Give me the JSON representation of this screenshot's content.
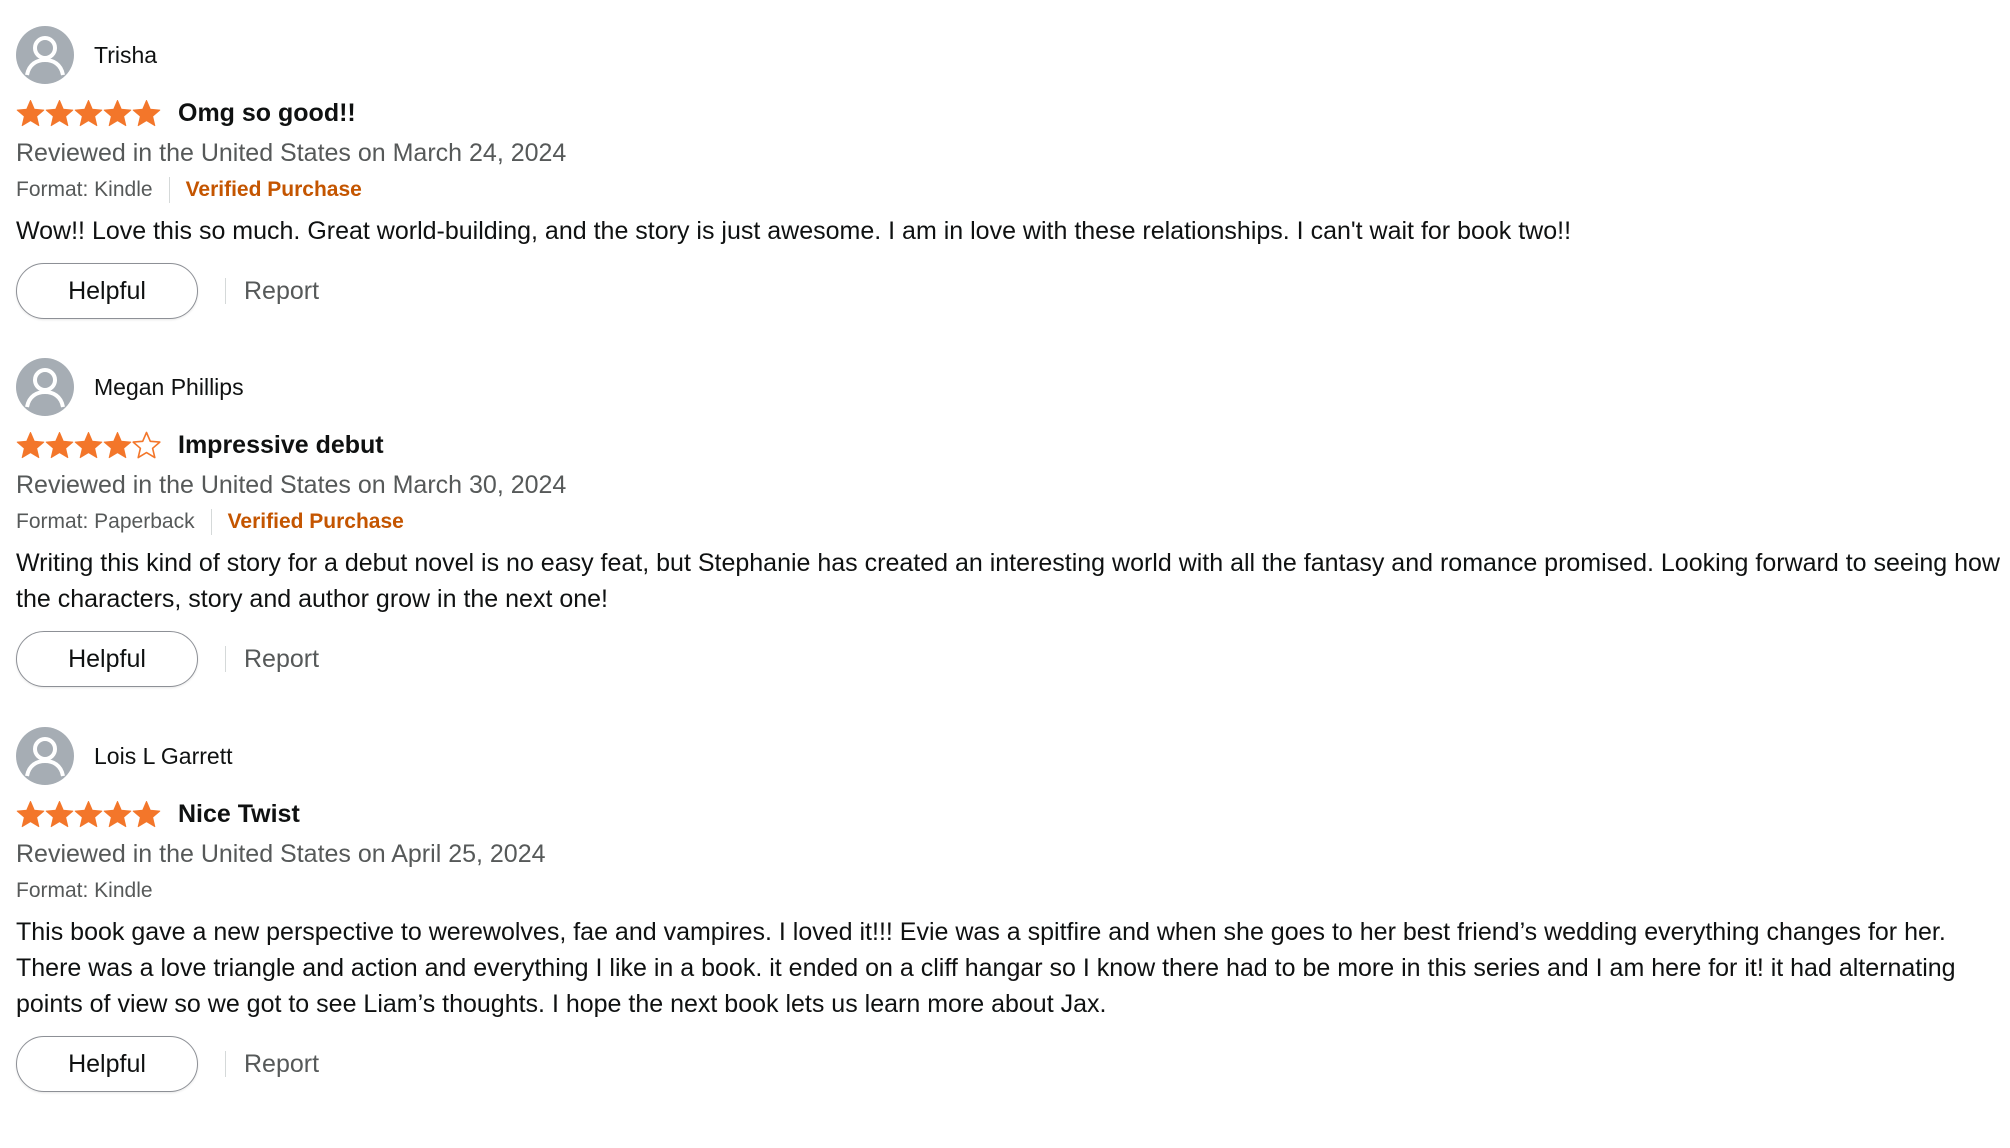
{
  "colors": {
    "star": "#f3762a",
    "verified": "#c45500",
    "secondary_text": "#565959",
    "primary_text": "#0f1111",
    "avatar_bg": "#a6adb4"
  },
  "icons": {
    "avatar": "user-silhouette-icon",
    "star_filled": "star-filled-icon",
    "star_empty": "star-outline-icon"
  },
  "reviews": [
    {
      "profile_name": "Trisha",
      "rating": 5,
      "title": "Omg so good!!",
      "date": "Reviewed in the United States on March 24, 2024",
      "format": "Format: Kindle",
      "verified": "Verified Purchase",
      "body": "Wow!! Love this so much. Great world-building, and the story is just awesome. I am in love with these relationships. I can't wait for book two!!",
      "helpful_label": "Helpful",
      "report_label": "Report"
    },
    {
      "profile_name": "Megan Phillips",
      "rating": 4,
      "title": "Impressive debut",
      "date": "Reviewed in the United States on March 30, 2024",
      "format": "Format: Paperback",
      "verified": "Verified Purchase",
      "body": "Writing this kind of story for a debut novel is no easy feat, but Stephanie has created an interesting world with all the fantasy and romance promised. Looking forward to seeing how the characters, story and author grow in the next one!",
      "helpful_label": "Helpful",
      "report_label": "Report"
    },
    {
      "profile_name": "Lois L Garrett",
      "rating": 5,
      "title": "Nice Twist",
      "date": "Reviewed in the United States on April 25, 2024",
      "format": "Format: Kindle",
      "verified": "",
      "body": "This book gave a new perspective to werewolves, fae and vampires. I loved it!!! Evie was a spitfire and when she goes to her best friend’s wedding everything changes for her. There was a love triangle and action and everything I like in a book. it ended on a cliff hangar so I know there had to be more in this series and I am here for it! it had alternating points of view so we got to see Liam’s thoughts. I hope the next book lets us learn more about Jax.",
      "helpful_label": "Helpful",
      "report_label": "Report"
    }
  ]
}
